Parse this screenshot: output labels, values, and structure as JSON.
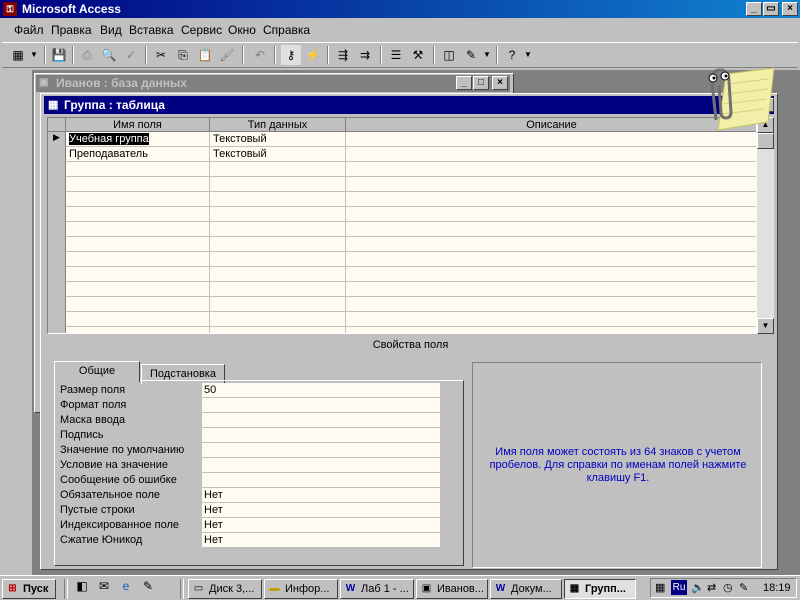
{
  "app": {
    "title": "Microsoft Access"
  },
  "menu": [
    "Файл",
    "Правка",
    "Вид",
    "Вставка",
    "Сервис",
    "Окно",
    "Справка"
  ],
  "db_window": {
    "title": "Иванов : база данных"
  },
  "table_window": {
    "title": "Группа : таблица"
  },
  "grid": {
    "headers": [
      "Имя поля",
      "Тип данных",
      "Описание"
    ],
    "rows": [
      {
        "name": "Учебная группа",
        "type": "Текстовый",
        "desc": ""
      },
      {
        "name": "Преподаватель",
        "type": "Текстовый",
        "desc": ""
      }
    ]
  },
  "properties": {
    "section_label": "Свойства поля",
    "tabs": [
      "Общие",
      "Подстановка"
    ],
    "fields": [
      {
        "label": "Размер поля",
        "value": "50"
      },
      {
        "label": "Формат поля",
        "value": ""
      },
      {
        "label": "Маска ввода",
        "value": ""
      },
      {
        "label": "Подпись",
        "value": ""
      },
      {
        "label": "Значение по умолчанию",
        "value": ""
      },
      {
        "label": "Условие на значение",
        "value": ""
      },
      {
        "label": "Сообщение об ошибке",
        "value": ""
      },
      {
        "label": "Обязательное поле",
        "value": "Нет"
      },
      {
        "label": "Пустые строки",
        "value": "Нет"
      },
      {
        "label": "Индексированное поле",
        "value": "Нет"
      },
      {
        "label": "Сжатие Юникод",
        "value": "Нет"
      }
    ],
    "help": "Имя поля может состоять из 64 знаков с учетом пробелов.  Для справки по именам полей нажмите клавишу F1."
  },
  "taskbar": {
    "start": "Пуск",
    "tasks": [
      "Диск 3,...",
      "Инфор...",
      "Лаб 1 - ...",
      "Иванов...",
      "Докум...",
      "Групп..."
    ],
    "lang": "Ru",
    "clock": "18:19"
  },
  "colors": {
    "title_active": "#000080",
    "title_inactive": "#808080",
    "help_text": "#0000c0",
    "grid_bg": "#fffbf0"
  }
}
